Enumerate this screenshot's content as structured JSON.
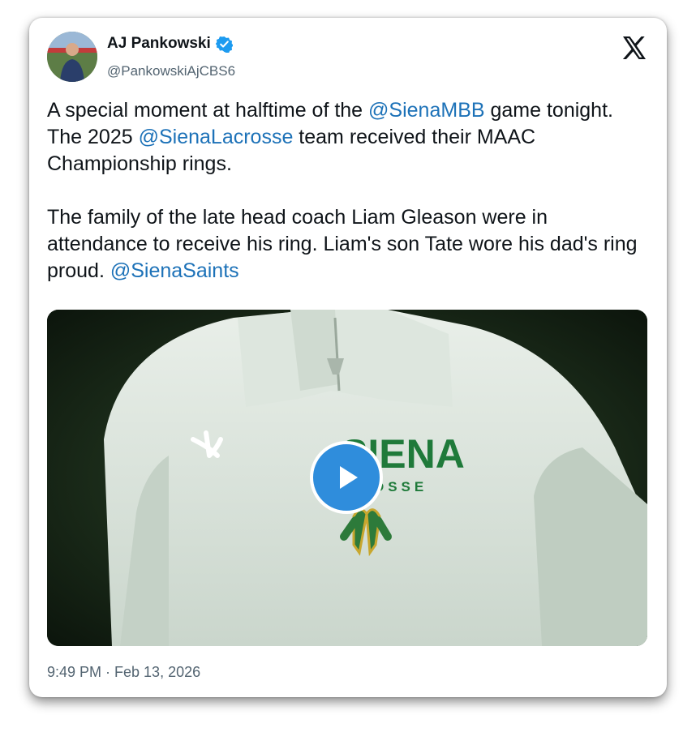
{
  "author": {
    "name": "AJ Pankowski",
    "handle": "@PankowskiAjCBS6",
    "verified": true
  },
  "tweet": {
    "paragraph1": [
      {
        "text": "A special moment at halftime of the "
      },
      {
        "text": "@SienaMBB",
        "mention": true
      },
      {
        "text": " game tonight. The 2025 "
      },
      {
        "text": "@SienaLacrosse",
        "mention": true
      },
      {
        "text": " team received their MAAC Championship rings."
      }
    ],
    "paragraph2": [
      {
        "text": "The family of the late head coach Liam Gleason were in attendance to receive his ring. Liam's son Tate wore his dad's ring proud. "
      },
      {
        "text": "@SienaSaints",
        "mention": true
      }
    ],
    "timestamp": "9:49 PM · Feb 13, 2026"
  },
  "media": {
    "type": "video",
    "shirt_text": "SIENA",
    "shirt_subtext": "OSSE"
  },
  "colors": {
    "mention": "#1d72b8",
    "verified": "#1d9bf0",
    "play": "#2f8ddc"
  }
}
